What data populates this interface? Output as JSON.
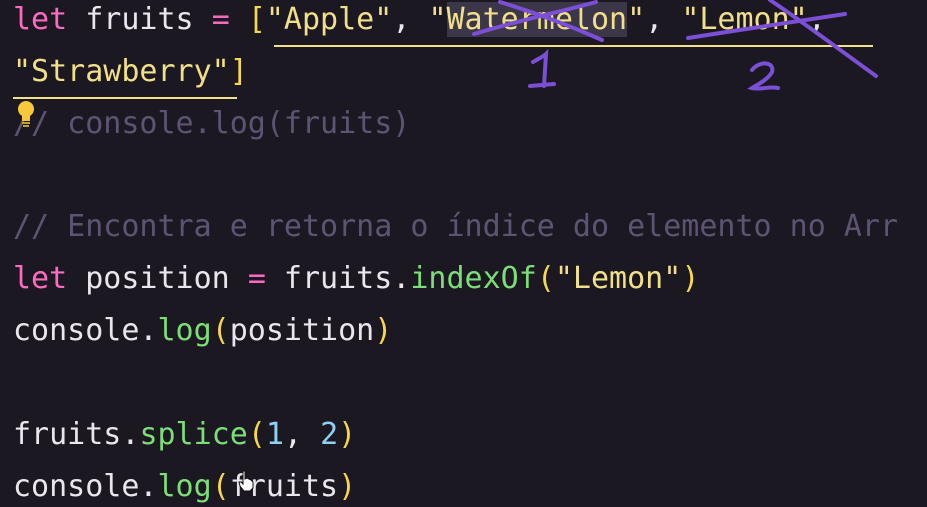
{
  "editor": {
    "lines": [
      {
        "id": "line-1",
        "tokens": [
          {
            "text": "let",
            "kind": "keyword"
          },
          {
            "text": " fruits ",
            "kind": "plain"
          },
          {
            "text": "=",
            "kind": "operator"
          },
          {
            "text": " ",
            "kind": "plain"
          },
          {
            "text": "[",
            "kind": "bracket"
          },
          {
            "text": "\"Apple\"",
            "kind": "string"
          },
          {
            "text": ", ",
            "kind": "plain"
          },
          {
            "text": "\"",
            "kind": "string"
          },
          {
            "text": "Watermelon",
            "kind": "string-selected"
          },
          {
            "text": "\"",
            "kind": "string"
          },
          {
            "text": ", ",
            "kind": "plain"
          },
          {
            "text": "\"Lemon\"",
            "kind": "string"
          },
          {
            "text": ",",
            "kind": "plain"
          }
        ]
      },
      {
        "id": "line-2",
        "tokens": [
          {
            "text": "\"Strawberry\"",
            "kind": "string"
          },
          {
            "text": "]",
            "kind": "bracket"
          }
        ]
      },
      {
        "id": "line-3",
        "tokens": [
          {
            "text": "// console.log(fruits)",
            "kind": "comment"
          }
        ]
      },
      {
        "id": "line-4",
        "tokens": []
      },
      {
        "id": "line-5",
        "tokens": [
          {
            "text": "// Encontra e retorna o índice do elemento no Arr",
            "kind": "comment"
          }
        ]
      },
      {
        "id": "line-6",
        "tokens": [
          {
            "text": "let",
            "kind": "keyword"
          },
          {
            "text": " position ",
            "kind": "plain"
          },
          {
            "text": "=",
            "kind": "operator"
          },
          {
            "text": " fruits.",
            "kind": "plain"
          },
          {
            "text": "indexOf",
            "kind": "function"
          },
          {
            "text": "(",
            "kind": "bracket"
          },
          {
            "text": "\"Lemon\"",
            "kind": "string"
          },
          {
            "text": ")",
            "kind": "bracket"
          }
        ]
      },
      {
        "id": "line-7",
        "tokens": [
          {
            "text": "console.",
            "kind": "plain"
          },
          {
            "text": "log",
            "kind": "function"
          },
          {
            "text": "(",
            "kind": "bracket"
          },
          {
            "text": "position",
            "kind": "plain"
          },
          {
            "text": ")",
            "kind": "bracket"
          }
        ]
      },
      {
        "id": "line-8",
        "tokens": []
      },
      {
        "id": "line-9",
        "tokens": [
          {
            "text": "fruits.",
            "kind": "plain"
          },
          {
            "text": "splice",
            "kind": "function"
          },
          {
            "text": "(",
            "kind": "bracket"
          },
          {
            "text": "1",
            "kind": "number"
          },
          {
            "text": ", ",
            "kind": "plain"
          },
          {
            "text": "2",
            "kind": "number"
          },
          {
            "text": ")",
            "kind": "bracket"
          }
        ]
      },
      {
        "id": "line-10",
        "tokens": [
          {
            "text": "console.",
            "kind": "plain"
          },
          {
            "text": "log",
            "kind": "function"
          },
          {
            "text": "(",
            "kind": "bracket"
          },
          {
            "text": "fruits",
            "kind": "plain"
          },
          {
            "text": ")",
            "kind": "bracket"
          }
        ]
      }
    ]
  },
  "annotations": {
    "label_one": "1",
    "label_two": "2",
    "ink_color": "#7b4fd6"
  },
  "icons": {
    "lightbulb": "lightbulb-icon",
    "cursor": "hand-pointer-icon"
  },
  "colors": {
    "background": "#1c1822",
    "keyword": "#ff6ac1",
    "string": "#f1e08a",
    "number": "#8fd1f5",
    "function": "#7cde76",
    "bracket": "#f6d84a",
    "comment": "#5e5472",
    "plain": "#e9e6ee"
  }
}
